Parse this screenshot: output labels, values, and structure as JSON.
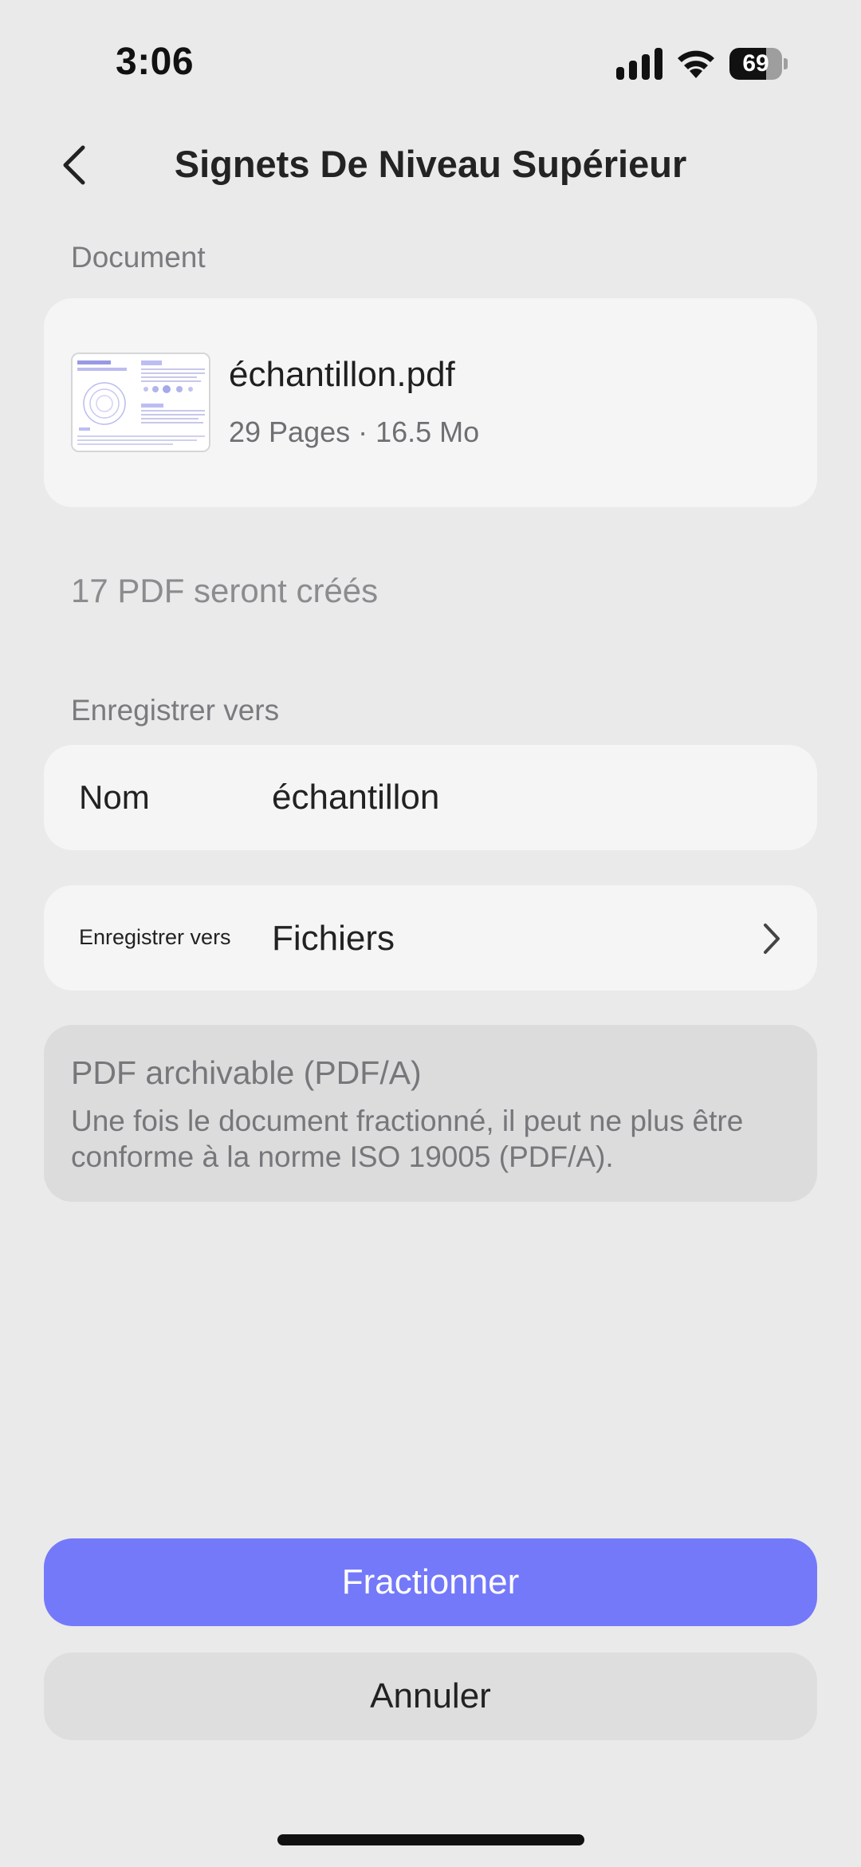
{
  "status_bar": {
    "time": "3:06",
    "battery_level": "69",
    "icons": [
      "cellular-signal-icon",
      "wifi-icon",
      "battery-icon"
    ]
  },
  "header": {
    "back_icon": "chevron-left-icon",
    "title": "Signets De Niveau Supérieur"
  },
  "document": {
    "section_label": "Document",
    "file_name": "échantillon.pdf",
    "file_meta": "29 Pages · 16.5 Mo"
  },
  "summary": {
    "created_text": "17 PDF seront créés"
  },
  "save": {
    "section_label": "Enregistrer vers",
    "name_label": "Nom",
    "name_value": "échantillon",
    "location_label": "Enregistrer vers",
    "location_value": "Fichiers",
    "location_icon": "chevron-right-icon"
  },
  "archive": {
    "title": "PDF archivable (PDF/A)",
    "description": "Une fois le document fractionné, il peut ne plus être conforme à la norme ISO 19005 (PDF/A)."
  },
  "actions": {
    "primary_label": "Fractionner",
    "secondary_label": "Annuler"
  },
  "colors": {
    "background": "#eaeaea",
    "card": "#f5f5f5",
    "accent": "#7479fa",
    "disabled_card": "#dcdcdc"
  }
}
